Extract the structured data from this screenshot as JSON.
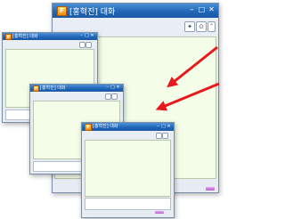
{
  "app_icon_text": "F",
  "windows": [
    {
      "title": "[홍혁진] 대화",
      "controls": [
        "–",
        "□",
        "✕"
      ]
    },
    {
      "title": "[홍혁진] 대화",
      "controls": [
        "–",
        "□",
        "✕"
      ]
    },
    {
      "title": "[홍혁진] 대화",
      "controls": [
        "–",
        "□",
        "✕"
      ]
    },
    {
      "title": "[홍혁진] 대화",
      "controls": [
        "–",
        "□",
        "✕"
      ]
    }
  ],
  "colors": {
    "titlebar": "#1f63b4",
    "content_background": "#f4fde8",
    "arrow": "#e8191c",
    "send_button": "#c46fd8"
  }
}
